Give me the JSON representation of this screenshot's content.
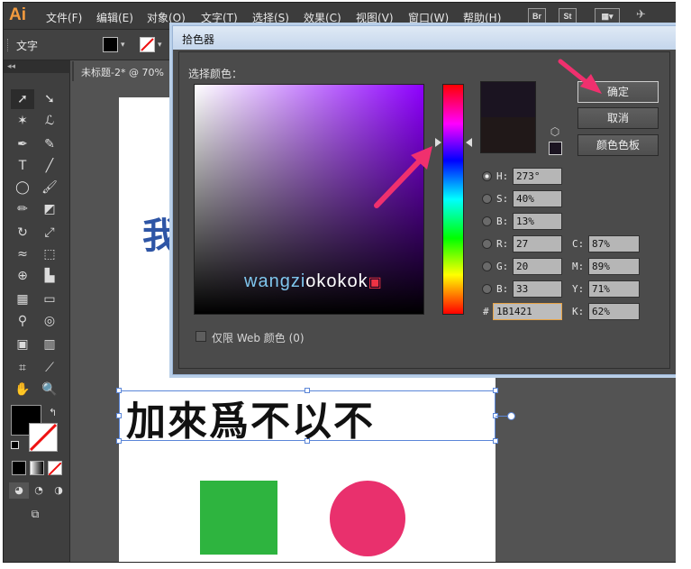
{
  "app": {
    "logo": "Ai",
    "menus": [
      "文件(F)",
      "编辑(E)",
      "对象(O)",
      "文字(T)",
      "选择(S)",
      "效果(C)",
      "视图(V)",
      "窗口(W)",
      "帮助(H)"
    ],
    "app_buttons": [
      "Br",
      "St"
    ]
  },
  "control_bar": {
    "label": "文字"
  },
  "document": {
    "tab_title": "未标题-2* @ 70%"
  },
  "toolbox": {
    "collapse": "◂◂"
  },
  "canvas": {
    "partial_blue_text": "我",
    "calligraphy_text": "加來爲不以不"
  },
  "dialog": {
    "title": "拾色器",
    "section_label": "选择颜色：",
    "watermark_blue": "wangzi",
    "watermark_white": "okokok",
    "buttons": {
      "ok": "确定",
      "cancel": "取消",
      "swatches": "颜色色板"
    },
    "hsb": [
      {
        "label": "H:",
        "value": "273°",
        "selected": true
      },
      {
        "label": "S:",
        "value": "40%",
        "selected": false
      },
      {
        "label": "B:",
        "value": "13%",
        "selected": false
      }
    ],
    "rgb": [
      {
        "label": "R:",
        "value": "27"
      },
      {
        "label": "G:",
        "value": "20"
      },
      {
        "label": "B:",
        "value": "33"
      }
    ],
    "cmyk": [
      {
        "label": "C:",
        "value": "87%"
      },
      {
        "label": "M:",
        "value": "89%"
      },
      {
        "label": "Y:",
        "value": "71%"
      },
      {
        "label": "K:",
        "value": "62%"
      }
    ],
    "hex_label": "#",
    "hex_value": "1B1421",
    "web_only_label": "仅限 Web 颜色 (0)",
    "new_color": "#1b1421",
    "old_color": "#201818"
  },
  "colors": {
    "fill": "#000000",
    "green_shape": "#2eb43f",
    "pink_shape": "#e9306d",
    "annotation_arrow": "#f0306e"
  }
}
